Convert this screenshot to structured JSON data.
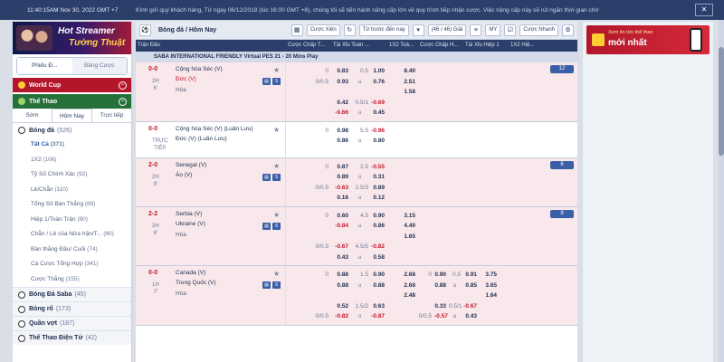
{
  "topbar": {
    "clock": "11:40:15AM Nov 30, 2022 GMT +7",
    "marquee": "Kính gửi quý khách hàng, Từ ngày 06/12/2018 (lúc 16:00 GMT +8), chúng tôi sẽ tiến hành nâng cấp lớn về quy trình tiếp nhận cược. Việc nâng cấp này sẽ rút ngắn thời gian chờ",
    "close": "✕"
  },
  "sidebar": {
    "promo_line1": "Hot Streamer",
    "promo_line2": "Tường Thuật",
    "bet_tab_active": "Phiếu Đ...",
    "bet_tab_other": "Bảng Cược",
    "world_cup": "World Cup",
    "the_thao": "Thể Thao",
    "subtabs": [
      "Sớm",
      "Hôm Nay",
      "Trực tiếp"
    ],
    "football": {
      "name": "Bóng đá",
      "count": "(526)"
    },
    "markets": [
      {
        "label": "Tất Cả",
        "count": "(371)"
      },
      {
        "label": "1X2",
        "count": "(106)"
      },
      {
        "label": "Tỷ Số Chính Xác",
        "count": "(92)"
      },
      {
        "label": "Lẻ/Chẵn",
        "count": "(110)"
      },
      {
        "label": "Tổng Số Bàn Thắng",
        "count": "(89)"
      },
      {
        "label": "Hiệp 1/Toàn Trận",
        "count": "(80)"
      },
      {
        "label": "Chẵn / Lẻ của Nửa trận/T...",
        "count": "(80)"
      },
      {
        "label": "Bàn thắng Đầu/ Cuối",
        "count": "(74)"
      },
      {
        "label": "Cá Cược Tổng Hợp",
        "count": "(341)"
      },
      {
        "label": "Cược Thắng",
        "count": "(155)"
      }
    ],
    "other_sports": [
      {
        "name": "Bóng Đá Saba",
        "count": "(45)"
      },
      {
        "name": "Bóng rổ",
        "count": "(173)"
      },
      {
        "name": "Quần vợt",
        "count": "(187)"
      },
      {
        "name": "Thể Thao Điện Tử",
        "count": "(42)"
      }
    ]
  },
  "toolbar": {
    "title": "Bóng đá / Hôm Nay",
    "cuoc_xien": "Cược Xiên",
    "sort": "Từ trước đến nay",
    "pager": "(46 / 46) Giải",
    "odds_type": "MY",
    "quick_bet": "Cược Nhanh"
  },
  "table_head": [
    "Trận Đấu",
    "Cược Chấp T...",
    "Tài Xỉu Toàn ...",
    "1X2 Toả...",
    "Cược Chấp H...",
    "Tài Xỉu Hiệp 1",
    "1X2 Hiệ...",
    ""
  ],
  "league": "SABA INTERNATIONAL FRIENDLY Virtual PES 21 - 20 Mins Play",
  "matches": [
    {
      "score": "0-0",
      "period1": "2H",
      "period2": "6'",
      "home": "Cộng hòa Séc (V)",
      "away": "Đức (V)",
      "draw": "Hòa",
      "live": true,
      "away_red": true,
      "more": "12",
      "rows": [
        [
          "",
          "0",
          "0.83",
          "0.5",
          "1.00",
          "8.40",
          "",
          "",
          "",
          "",
          "",
          ""
        ],
        [
          "",
          "0/0.5",
          "0.93",
          "u",
          "0.76",
          "2.51",
          "",
          "",
          "",
          "",
          "",
          ""
        ],
        [
          "",
          "",
          "",
          "",
          "",
          "1.58",
          "",
          "",
          "",
          "",
          "",
          ""
        ],
        [
          "",
          "",
          "0.42",
          "0.5/1",
          "-0.69",
          "",
          "",
          "",
          "",
          "",
          "",
          ""
        ],
        [
          "",
          "",
          "-0.66",
          "u",
          "0.45",
          "",
          "",
          "",
          "",
          "",
          "",
          ""
        ]
      ]
    },
    {
      "score": "0-0",
      "period1": "TRỰC",
      "period2": "TIẾP",
      "home": "Cộng hòa Séc (V) (Luân Lưu)",
      "away": "Đức (V) (Luân Lưu)",
      "draw": "",
      "live": false,
      "away_red": false,
      "more": "",
      "rows": [
        [
          "",
          "0",
          "0.98",
          "5.5",
          "-0.96",
          "",
          "",
          "",
          "",
          "",
          "",
          ""
        ],
        [
          "",
          "",
          "0.86",
          "u",
          "0.80",
          "",
          "",
          "",
          "",
          "",
          "",
          ""
        ]
      ]
    },
    {
      "score": "2-0",
      "period1": "2H",
      "period2": "9'",
      "home": "Senegal (V)",
      "away": "Áo (V)",
      "draw": "",
      "live": true,
      "away_red": false,
      "more": "6",
      "rows": [
        [
          "",
          "0",
          "0.87",
          "2.5",
          "-0.55",
          "",
          "",
          "",
          "",
          "",
          "",
          ""
        ],
        [
          "",
          "",
          "0.89",
          "u",
          "0.31",
          "",
          "",
          "",
          "",
          "",
          "",
          ""
        ],
        [
          "",
          "0/0.5",
          "-0.63",
          "2.5/3",
          "0.89",
          "",
          "",
          "",
          "",
          "",
          "",
          ""
        ],
        [
          "",
          "",
          "0.16",
          "u",
          "0.12",
          "",
          "",
          "",
          "",
          "",
          "",
          ""
        ]
      ]
    },
    {
      "score": "2-2",
      "period1": "2H",
      "period2": "6'",
      "home": "Serbia (V)",
      "away": "Ukraine (V)",
      "draw": "Hòa",
      "live": true,
      "away_red": false,
      "more": "9",
      "rows": [
        [
          "",
          "0",
          "0.60",
          "4.5",
          "0.90",
          "3.15",
          "",
          "",
          "",
          "",
          "",
          ""
        ],
        [
          "",
          "",
          "-0.84",
          "u",
          "0.86",
          "4.40",
          "",
          "",
          "",
          "",
          "",
          ""
        ],
        [
          "",
          "",
          "",
          "",
          "",
          "1.65",
          "",
          "",
          "",
          "",
          "",
          ""
        ],
        [
          "",
          "0/0.5",
          "-0.67",
          "4.5/5",
          "-0.82",
          "",
          "",
          "",
          "",
          "",
          "",
          ""
        ],
        [
          "",
          "",
          "0.43",
          "u",
          "0.58",
          "",
          "",
          "",
          "",
          "",
          "",
          ""
        ]
      ]
    },
    {
      "score": "0-0",
      "period1": "1H",
      "period2": "7'",
      "home": "Canada (V)",
      "away": "Trung Quốc (V)",
      "draw": "Hòa",
      "live": true,
      "away_red": false,
      "more": "",
      "rows": [
        [
          "",
          "0",
          "0.88",
          "1.5",
          "0.90",
          "2.68",
          "0",
          "0.90",
          "0.5",
          "0.91",
          "3.75",
          ""
        ],
        [
          "",
          "",
          "0.88",
          "u",
          "0.88",
          "2.68",
          "",
          "0.88",
          "u",
          "0.85",
          "3.65",
          ""
        ],
        [
          "",
          "",
          "",
          "",
          "",
          "2.48",
          "",
          "",
          "",
          "",
          "1.64",
          ""
        ],
        [
          "",
          "",
          "0.52",
          "1.5/2",
          "0.63",
          "",
          "",
          "0.33",
          "0.5/1",
          "-0.67",
          "",
          ""
        ],
        [
          "",
          "0/0.5",
          "-0.82",
          "u",
          "-0.87",
          "",
          "0/0.5",
          "-0.57",
          "u",
          "0.43",
          "",
          ""
        ]
      ]
    }
  ],
  "right_panel": {
    "ad_line1": "Xem tin tức thể thao",
    "ad_line2": "mới nhất"
  },
  "colors": {
    "header_navy": "#2c3f6a",
    "live_row_pink": "#f9e8eb",
    "negative_red": "#c0182d",
    "world_cup_red": "#b3162a",
    "sports_green": "#26703a"
  }
}
